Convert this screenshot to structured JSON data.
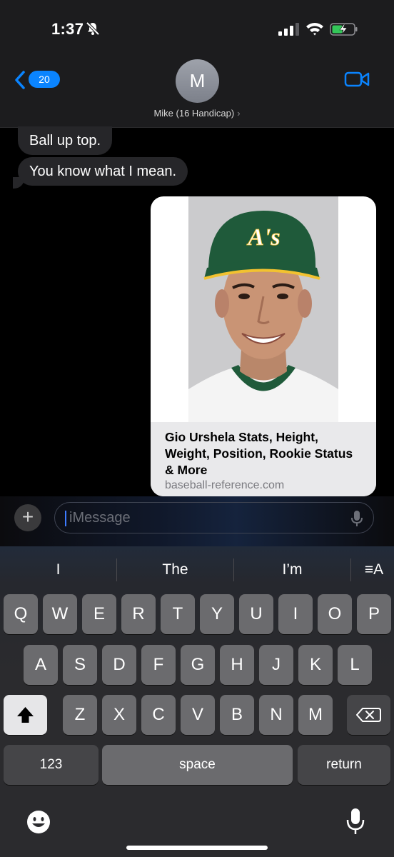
{
  "status_bar": {
    "time": "1:37"
  },
  "header": {
    "back_badge": "20",
    "avatar_initial": "M",
    "contact_name": "Mike (16 Handicap)",
    "name_chevron": "›"
  },
  "messages": [
    {
      "text": "Ball up top."
    },
    {
      "text": "You know what I mean."
    }
  ],
  "link_preview": {
    "title": "Gio Urshela Stats, Height, Weight, Position, Rookie Status & More",
    "domain": "baseball-reference.com",
    "cap_logo": "A's"
  },
  "composer": {
    "placeholder": "iMessage",
    "plus": "+"
  },
  "keyboard": {
    "suggestions": [
      "I",
      "The",
      "I’m"
    ],
    "format_label": "≡A",
    "row1": [
      "Q",
      "W",
      "E",
      "R",
      "T",
      "Y",
      "U",
      "I",
      "O",
      "P"
    ],
    "row2": [
      "A",
      "S",
      "D",
      "F",
      "G",
      "H",
      "J",
      "K",
      "L"
    ],
    "row3": [
      "Z",
      "X",
      "C",
      "V",
      "B",
      "N",
      "M"
    ],
    "numbers_label": "123",
    "space_label": "space",
    "return_label": "return"
  },
  "colors": {
    "accent": "#0a84ff",
    "bubble_in": "#262629",
    "keyboard_key": "#6b6b6e"
  }
}
